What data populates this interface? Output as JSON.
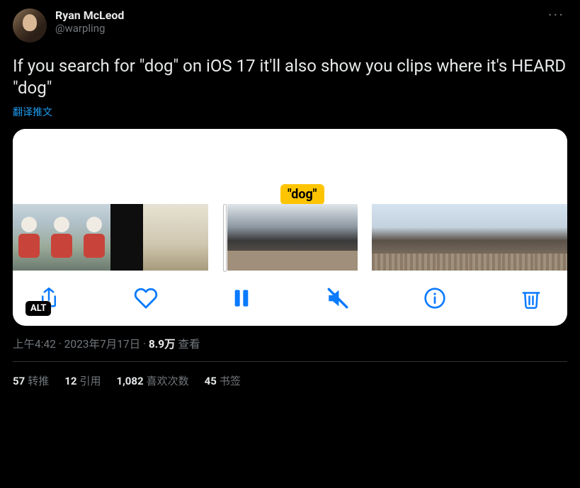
{
  "author": {
    "display_name": "Ryan McLeod",
    "handle": "@warpling"
  },
  "more_glyph": "···",
  "body": "If you search for \"dog\" on iOS 17 it'll also show you clips where it's HEARD \"dog\"",
  "translate": "翻译推文",
  "media": {
    "badge": "\"dog\"",
    "alt_label": "ALT"
  },
  "meta": {
    "time": "上午4:42",
    "sep1": " · ",
    "date": "2023年7月17日",
    "sep2": " · ",
    "views_count": "8.9万",
    "views_label": " 查看"
  },
  "stats": {
    "retweets_count": "57",
    "retweets_label": "转推",
    "quotes_count": "12",
    "quotes_label": "引用",
    "likes_count": "1,082",
    "likes_label": "喜欢次数",
    "bookmarks_count": "45",
    "bookmarks_label": "书签"
  }
}
